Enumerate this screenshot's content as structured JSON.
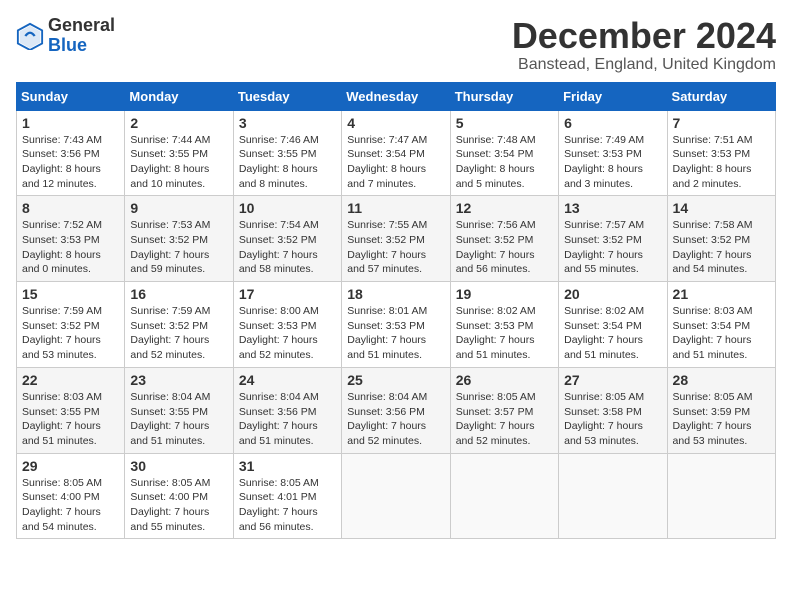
{
  "header": {
    "logo_general": "General",
    "logo_blue": "Blue",
    "month_title": "December 2024",
    "location": "Banstead, England, United Kingdom"
  },
  "days_of_week": [
    "Sunday",
    "Monday",
    "Tuesday",
    "Wednesday",
    "Thursday",
    "Friday",
    "Saturday"
  ],
  "weeks": [
    [
      {
        "day": "1",
        "sunrise": "Sunrise: 7:43 AM",
        "sunset": "Sunset: 3:56 PM",
        "daylight": "Daylight: 8 hours and 12 minutes."
      },
      {
        "day": "2",
        "sunrise": "Sunrise: 7:44 AM",
        "sunset": "Sunset: 3:55 PM",
        "daylight": "Daylight: 8 hours and 10 minutes."
      },
      {
        "day": "3",
        "sunrise": "Sunrise: 7:46 AM",
        "sunset": "Sunset: 3:55 PM",
        "daylight": "Daylight: 8 hours and 8 minutes."
      },
      {
        "day": "4",
        "sunrise": "Sunrise: 7:47 AM",
        "sunset": "Sunset: 3:54 PM",
        "daylight": "Daylight: 8 hours and 7 minutes."
      },
      {
        "day": "5",
        "sunrise": "Sunrise: 7:48 AM",
        "sunset": "Sunset: 3:54 PM",
        "daylight": "Daylight: 8 hours and 5 minutes."
      },
      {
        "day": "6",
        "sunrise": "Sunrise: 7:49 AM",
        "sunset": "Sunset: 3:53 PM",
        "daylight": "Daylight: 8 hours and 3 minutes."
      },
      {
        "day": "7",
        "sunrise": "Sunrise: 7:51 AM",
        "sunset": "Sunset: 3:53 PM",
        "daylight": "Daylight: 8 hours and 2 minutes."
      }
    ],
    [
      {
        "day": "8",
        "sunrise": "Sunrise: 7:52 AM",
        "sunset": "Sunset: 3:53 PM",
        "daylight": "Daylight: 8 hours and 0 minutes."
      },
      {
        "day": "9",
        "sunrise": "Sunrise: 7:53 AM",
        "sunset": "Sunset: 3:52 PM",
        "daylight": "Daylight: 7 hours and 59 minutes."
      },
      {
        "day": "10",
        "sunrise": "Sunrise: 7:54 AM",
        "sunset": "Sunset: 3:52 PM",
        "daylight": "Daylight: 7 hours and 58 minutes."
      },
      {
        "day": "11",
        "sunrise": "Sunrise: 7:55 AM",
        "sunset": "Sunset: 3:52 PM",
        "daylight": "Daylight: 7 hours and 57 minutes."
      },
      {
        "day": "12",
        "sunrise": "Sunrise: 7:56 AM",
        "sunset": "Sunset: 3:52 PM",
        "daylight": "Daylight: 7 hours and 56 minutes."
      },
      {
        "day": "13",
        "sunrise": "Sunrise: 7:57 AM",
        "sunset": "Sunset: 3:52 PM",
        "daylight": "Daylight: 7 hours and 55 minutes."
      },
      {
        "day": "14",
        "sunrise": "Sunrise: 7:58 AM",
        "sunset": "Sunset: 3:52 PM",
        "daylight": "Daylight: 7 hours and 54 minutes."
      }
    ],
    [
      {
        "day": "15",
        "sunrise": "Sunrise: 7:59 AM",
        "sunset": "Sunset: 3:52 PM",
        "daylight": "Daylight: 7 hours and 53 minutes."
      },
      {
        "day": "16",
        "sunrise": "Sunrise: 7:59 AM",
        "sunset": "Sunset: 3:52 PM",
        "daylight": "Daylight: 7 hours and 52 minutes."
      },
      {
        "day": "17",
        "sunrise": "Sunrise: 8:00 AM",
        "sunset": "Sunset: 3:53 PM",
        "daylight": "Daylight: 7 hours and 52 minutes."
      },
      {
        "day": "18",
        "sunrise": "Sunrise: 8:01 AM",
        "sunset": "Sunset: 3:53 PM",
        "daylight": "Daylight: 7 hours and 51 minutes."
      },
      {
        "day": "19",
        "sunrise": "Sunrise: 8:02 AM",
        "sunset": "Sunset: 3:53 PM",
        "daylight": "Daylight: 7 hours and 51 minutes."
      },
      {
        "day": "20",
        "sunrise": "Sunrise: 8:02 AM",
        "sunset": "Sunset: 3:54 PM",
        "daylight": "Daylight: 7 hours and 51 minutes."
      },
      {
        "day": "21",
        "sunrise": "Sunrise: 8:03 AM",
        "sunset": "Sunset: 3:54 PM",
        "daylight": "Daylight: 7 hours and 51 minutes."
      }
    ],
    [
      {
        "day": "22",
        "sunrise": "Sunrise: 8:03 AM",
        "sunset": "Sunset: 3:55 PM",
        "daylight": "Daylight: 7 hours and 51 minutes."
      },
      {
        "day": "23",
        "sunrise": "Sunrise: 8:04 AM",
        "sunset": "Sunset: 3:55 PM",
        "daylight": "Daylight: 7 hours and 51 minutes."
      },
      {
        "day": "24",
        "sunrise": "Sunrise: 8:04 AM",
        "sunset": "Sunset: 3:56 PM",
        "daylight": "Daylight: 7 hours and 51 minutes."
      },
      {
        "day": "25",
        "sunrise": "Sunrise: 8:04 AM",
        "sunset": "Sunset: 3:56 PM",
        "daylight": "Daylight: 7 hours and 52 minutes."
      },
      {
        "day": "26",
        "sunrise": "Sunrise: 8:05 AM",
        "sunset": "Sunset: 3:57 PM",
        "daylight": "Daylight: 7 hours and 52 minutes."
      },
      {
        "day": "27",
        "sunrise": "Sunrise: 8:05 AM",
        "sunset": "Sunset: 3:58 PM",
        "daylight": "Daylight: 7 hours and 53 minutes."
      },
      {
        "day": "28",
        "sunrise": "Sunrise: 8:05 AM",
        "sunset": "Sunset: 3:59 PM",
        "daylight": "Daylight: 7 hours and 53 minutes."
      }
    ],
    [
      {
        "day": "29",
        "sunrise": "Sunrise: 8:05 AM",
        "sunset": "Sunset: 4:00 PM",
        "daylight": "Daylight: 7 hours and 54 minutes."
      },
      {
        "day": "30",
        "sunrise": "Sunrise: 8:05 AM",
        "sunset": "Sunset: 4:00 PM",
        "daylight": "Daylight: 7 hours and 55 minutes."
      },
      {
        "day": "31",
        "sunrise": "Sunrise: 8:05 AM",
        "sunset": "Sunset: 4:01 PM",
        "daylight": "Daylight: 7 hours and 56 minutes."
      },
      null,
      null,
      null,
      null
    ]
  ]
}
